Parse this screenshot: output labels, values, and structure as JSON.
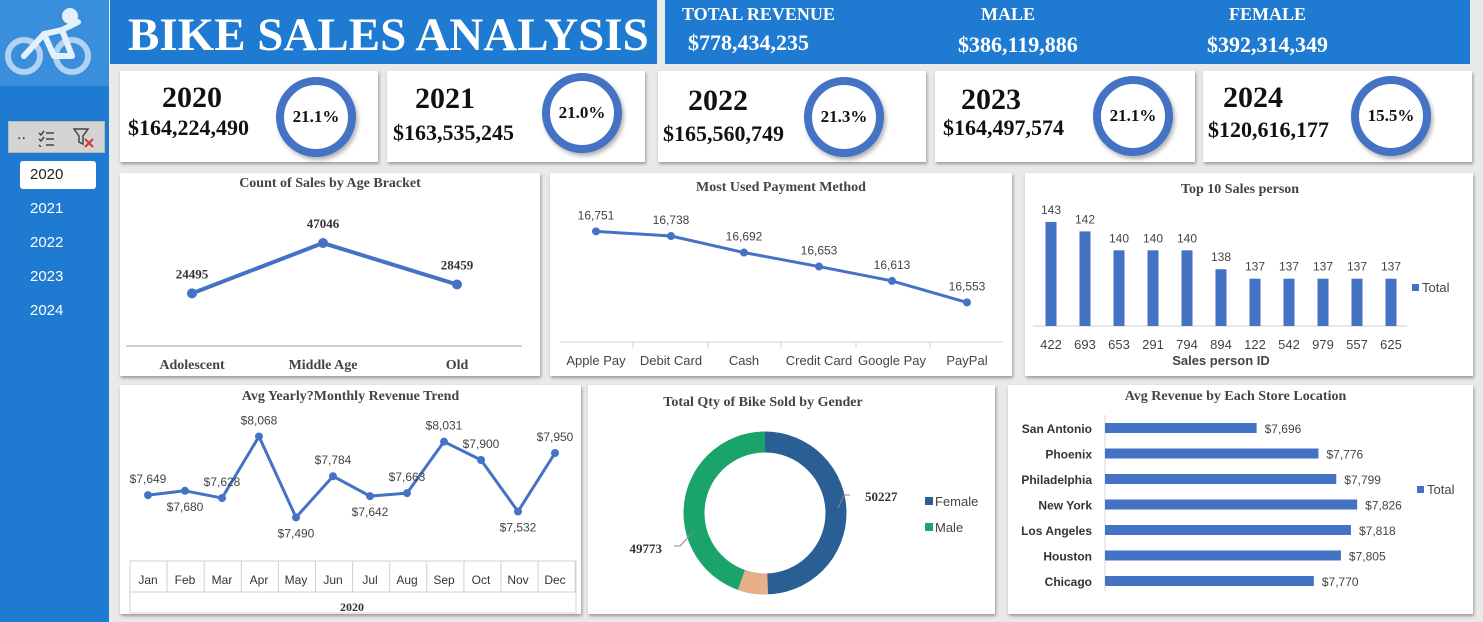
{
  "dashboard": {
    "title": "BIKE SALES ANALYSIS",
    "logo_icon": "cyclist-icon"
  },
  "header": {
    "total_revenue_label": "TOTAL REVENUE",
    "total_revenue": "$778,434,235",
    "male_label": "MALE",
    "male": "$386,119,886",
    "female_label": "FEMALE",
    "female": "$392,314,349"
  },
  "slicer": {
    "toolbar_ellipsis": "..",
    "icons": [
      "multi-select-icon",
      "clear-filter-icon"
    ],
    "items": [
      "2020",
      "2021",
      "2022",
      "2023",
      "2024"
    ],
    "selected": "2020"
  },
  "years": [
    {
      "year": "2020",
      "revenue": "$164,224,490",
      "pct": "21.1%",
      "share": 0.211
    },
    {
      "year": "2021",
      "revenue": "$163,535,245",
      "pct": "21.0%",
      "share": 0.21
    },
    {
      "year": "2022",
      "revenue": "$165,560,749",
      "pct": "21.3%",
      "share": 0.213
    },
    {
      "year": "2023",
      "revenue": "$164,497,574",
      "pct": "21.1%",
      "share": 0.211
    },
    {
      "year": "2024",
      "revenue": "$120,616,177",
      "pct": "15.5%",
      "share": 0.155
    }
  ],
  "colors": {
    "accent": "#1f7bd1",
    "series": "#4472c4",
    "female": "#2a5f96",
    "male": "#1aa36b",
    "peach": "#e8b08a"
  },
  "chart_data": [
    {
      "id": "age",
      "type": "line",
      "title": "Count of Sales by Age Bracket",
      "categories": [
        "Adolescent",
        "Middle Age",
        "Old"
      ],
      "values": [
        24495,
        47046,
        28459
      ],
      "labels": [
        "24495",
        "47046",
        "28459"
      ],
      "ylim": [
        0,
        65000
      ]
    },
    {
      "id": "payment",
      "type": "line",
      "title": "Most Used Payment Method",
      "categories": [
        "Apple Pay",
        "Debit Card",
        "Cash",
        "Credit Card",
        "Google Pay",
        "PayPal"
      ],
      "values": [
        16751,
        16738,
        16692,
        16653,
        16613,
        16553
      ],
      "labels": [
        "16,751",
        "16,738",
        "16,692",
        "16,653",
        "16,613",
        "16,553"
      ],
      "ylim": [
        16440,
        16830
      ]
    },
    {
      "id": "salesperson",
      "type": "bar",
      "title": "Top 10  Sales person",
      "xlabel": "Sales person ID",
      "categories": [
        "422",
        "693",
        "653",
        "291",
        "794",
        "894",
        "122",
        "542",
        "979",
        "557",
        "625"
      ],
      "values": [
        143,
        142,
        140,
        140,
        140,
        138,
        137,
        137,
        137,
        137,
        137
      ],
      "labels": [
        "143",
        "142",
        "140",
        "140",
        "140",
        "138",
        "137",
        "137",
        "137",
        "137",
        "137"
      ],
      "ylim": [
        132,
        145
      ],
      "legend": "Total"
    },
    {
      "id": "monthly",
      "type": "line",
      "title": "Avg Yearly?Monthly Revenue Trend",
      "categories": [
        "Jan",
        "Feb",
        "Mar",
        "Apr",
        "May",
        "Jun",
        "Jul",
        "Aug",
        "Sep",
        "Oct",
        "Nov",
        "Dec"
      ],
      "group_label": "2020",
      "values": [
        7649,
        7680,
        7628,
        8068,
        7490,
        7784,
        7642,
        7663,
        8031,
        7900,
        7532,
        7950
      ],
      "labels": [
        "$7,649",
        "$7,680",
        "$7,628",
        "$8,068",
        "$7,490",
        "$7,784",
        "$7,642",
        "$7,663",
        "$8,031",
        "$7,900",
        "$7,532",
        "$7,950"
      ],
      "ylim": [
        7300,
        8100
      ]
    },
    {
      "id": "gender",
      "type": "pie",
      "title": "Total Qty of Bike Sold by Gender",
      "categories": [
        "Female",
        "Male"
      ],
      "values": [
        50227,
        49773
      ],
      "labels": [
        "50227",
        "49773"
      ]
    },
    {
      "id": "store",
      "type": "bar",
      "orientation": "horizontal",
      "title": "Avg Revenue by Each Store Location",
      "categories": [
        "San Antonio",
        "Phoenix",
        "Philadelphia",
        "New York",
        "Los Angeles",
        "Houston",
        "Chicago"
      ],
      "values": [
        7696,
        7776,
        7799,
        7826,
        7818,
        7805,
        7770
      ],
      "labels": [
        "$7,696",
        "$7,776",
        "$7,799",
        "$7,826",
        "$7,818",
        "$7,805",
        "$7,770"
      ],
      "xlim": [
        7500,
        7840
      ],
      "legend": "Total"
    }
  ]
}
